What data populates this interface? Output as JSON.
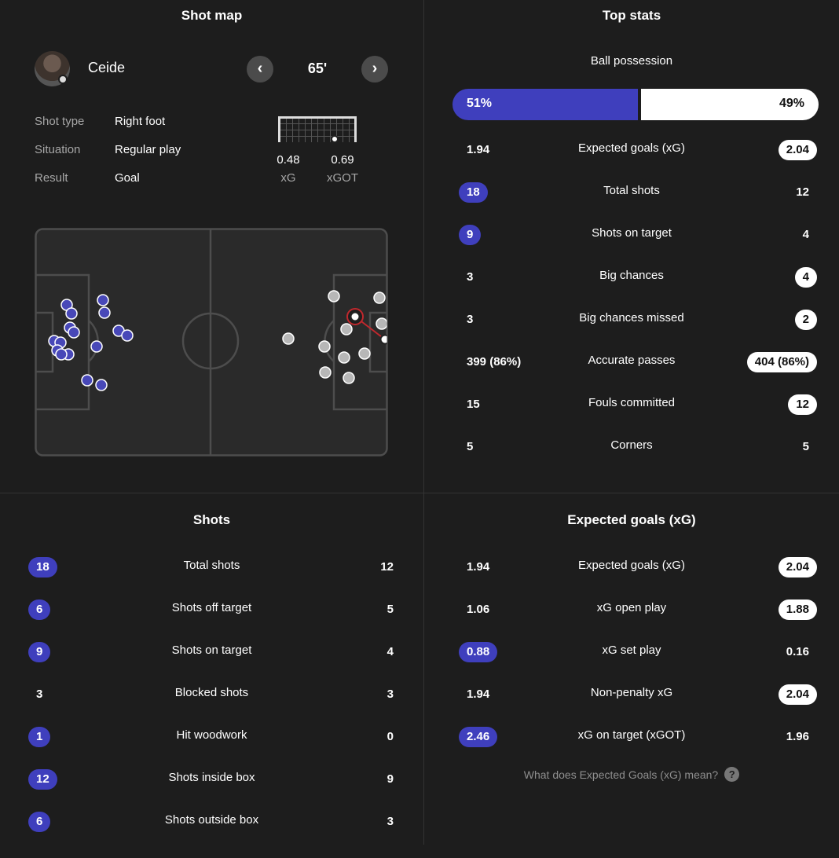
{
  "colors": {
    "background": "#1d1d1d",
    "home": "#3f3fbd",
    "away": "#ffffff",
    "goal_highlight": "#c0282d"
  },
  "shot_map": {
    "title": "Shot map",
    "player": {
      "name": "Ceide"
    },
    "minute": "65'",
    "nav": {
      "prev_icon": "‹",
      "next_icon": "›"
    },
    "info": [
      {
        "label": "Shot type",
        "value": "Right foot"
      },
      {
        "label": "Situation",
        "value": "Regular play"
      },
      {
        "label": "Result",
        "value": "Goal"
      }
    ],
    "xg": {
      "value": "0.48",
      "label": "xG"
    },
    "xgot": {
      "value": "0.69",
      "label": "xGOT"
    }
  },
  "top_stats": {
    "title": "Top stats",
    "possession": {
      "label": "Ball possession",
      "home": "51%",
      "away": "49%",
      "home_fraction": 0.51
    },
    "rows": [
      {
        "name": "Expected goals (xG)",
        "home": "1.94",
        "away": "2.04",
        "highlight": "away"
      },
      {
        "name": "Total shots",
        "home": "18",
        "away": "12",
        "highlight": "home"
      },
      {
        "name": "Shots on target",
        "home": "9",
        "away": "4",
        "highlight": "home"
      },
      {
        "name": "Big chances",
        "home": "3",
        "away": "4",
        "highlight": "away"
      },
      {
        "name": "Big chances missed",
        "home": "3",
        "away": "2",
        "highlight": "away"
      },
      {
        "name": "Accurate passes",
        "home": "399 (86%)",
        "away": "404 (86%)",
        "highlight": "away"
      },
      {
        "name": "Fouls committed",
        "home": "15",
        "away": "12",
        "highlight": "away"
      },
      {
        "name": "Corners",
        "home": "5",
        "away": "5",
        "highlight": "none"
      }
    ]
  },
  "shots": {
    "title": "Shots",
    "rows": [
      {
        "name": "Total shots",
        "home": "18",
        "away": "12",
        "highlight": "home"
      },
      {
        "name": "Shots off target",
        "home": "6",
        "away": "5",
        "highlight": "home"
      },
      {
        "name": "Shots on target",
        "home": "9",
        "away": "4",
        "highlight": "home"
      },
      {
        "name": "Blocked shots",
        "home": "3",
        "away": "3",
        "highlight": "none"
      },
      {
        "name": "Hit woodwork",
        "home": "1",
        "away": "0",
        "highlight": "home"
      },
      {
        "name": "Shots inside box",
        "home": "12",
        "away": "9",
        "highlight": "home"
      },
      {
        "name": "Shots outside box",
        "home": "6",
        "away": "3",
        "highlight": "home"
      }
    ]
  },
  "expected_goals": {
    "title": "Expected goals (xG)",
    "rows": [
      {
        "name": "Expected goals (xG)",
        "home": "1.94",
        "away": "2.04",
        "highlight": "away"
      },
      {
        "name": "xG open play",
        "home": "1.06",
        "away": "1.88",
        "highlight": "away"
      },
      {
        "name": "xG set play",
        "home": "0.88",
        "away": "0.16",
        "highlight": "home"
      },
      {
        "name": "Non-penalty xG",
        "home": "1.94",
        "away": "2.04",
        "highlight": "away"
      },
      {
        "name": "xG on target (xGOT)",
        "home": "2.46",
        "away": "1.96",
        "highlight": "home"
      }
    ],
    "help_text": "What does Expected Goals (xG) mean?",
    "help_icon": "?"
  }
}
